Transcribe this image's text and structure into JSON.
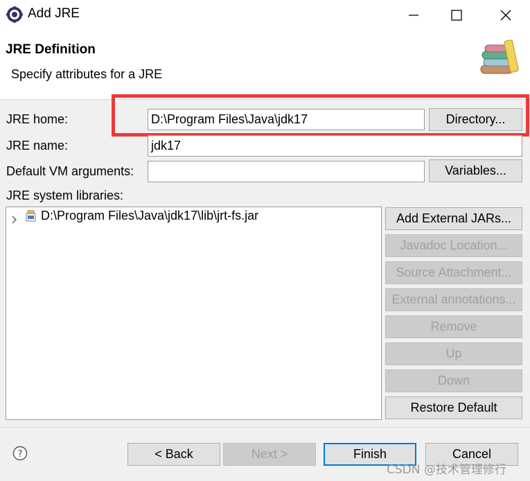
{
  "window": {
    "title": "Add JRE",
    "app_icon": "eclipse-gear-icon",
    "controls": {
      "minimize": "minimize-icon",
      "maximize": "maximize-icon",
      "close": "close-icon"
    }
  },
  "header": {
    "title": "JRE Definition",
    "description": "Specify attributes for a JRE",
    "icon": "library-books-icon"
  },
  "form": {
    "jre_home_label": "JRE home:",
    "jre_home_value": "D:\\Program Files\\Java\\jdk17",
    "directory_button": "Directory...",
    "jre_name_label": "JRE name:",
    "jre_name_value": "jdk17",
    "vm_args_label": "Default VM arguments:",
    "vm_args_value": "",
    "variables_button": "Variables...",
    "libraries_label": "JRE system libraries:"
  },
  "libraries": {
    "items": [
      {
        "label": "D:\\Program Files\\Java\\jdk17\\lib\\jrt-fs.jar",
        "icon": "jar-file-icon",
        "expander": "chevron-right-icon"
      }
    ]
  },
  "library_buttons": {
    "add_external_jars": "Add External JARs...",
    "javadoc_location": "Javadoc Location...",
    "source_attachment": "Source Attachment...",
    "external_annotations": "External annotations...",
    "remove": "Remove",
    "up": "Up",
    "down": "Down",
    "restore_default": "Restore Default"
  },
  "footer": {
    "help_icon": "help-icon",
    "back": "< Back",
    "next": "Next >",
    "finish": "Finish",
    "cancel": "Cancel"
  },
  "watermark": "CSDN @技术管理修行",
  "colors": {
    "highlight": "#ea3b3b",
    "default_button_border": "#0078d7",
    "disabled_text": "#a0a0a0"
  }
}
